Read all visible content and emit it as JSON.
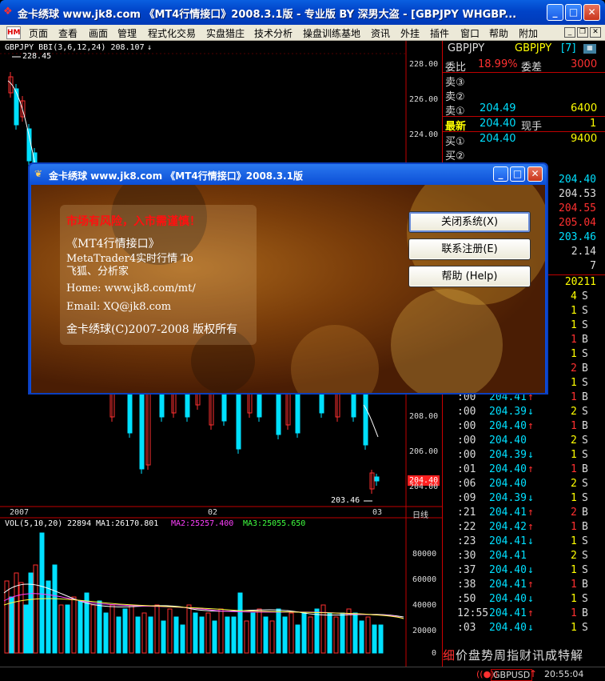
{
  "window": {
    "title": "金卡绣球 www.jk8.com 《MT4行情接口》2008.3.1版 - 专业版 BY 深男大盗 - [GBPJPY WHGBP...",
    "minimize": "_",
    "maximize": "□",
    "close": "✕"
  },
  "menu": {
    "items": [
      "页面",
      "查看",
      "画面",
      "管理",
      "程式化交易",
      "实盘猎庄",
      "技术分析",
      "操盘训练基地",
      "资讯",
      "外挂",
      "插件",
      "窗口",
      "帮助",
      "附加"
    ]
  },
  "chart": {
    "header": "GBPJPY BBI(3,6,12,24) 208.107",
    "header_arrow": "↓",
    "high_label": "228.45",
    "low_label": "203.46",
    "current_price": "204.40",
    "price_axis": [
      "228.00",
      "226.00",
      "224.00",
      "208.00",
      "206.00",
      "204.00"
    ],
    "date_axis": [
      "2007",
      "02",
      "03"
    ],
    "period": "日线",
    "volume_header": {
      "vol": "VOL(5,10,20)",
      "vol_value": "22894",
      "ma1": "MA1:26170.801",
      "ma2": "MA2:25257.400",
      "ma3": "MA3:25055.650"
    },
    "volume_axis": [
      "80000",
      "60000",
      "40000",
      "20000",
      "0"
    ]
  },
  "panel": {
    "symbol": "GBPJPY",
    "symbol_name": "GBPJPY",
    "symbol_suffix": "[7]",
    "ratio_label": "委比",
    "ratio_value": "18.99%",
    "diff_label": "委差",
    "diff_value": "3000",
    "sell": [
      {
        "label": "卖③",
        "price": "",
        "vol": ""
      },
      {
        "label": "卖②",
        "price": "",
        "vol": ""
      },
      {
        "label": "卖①",
        "price": "204.49",
        "vol": "6400"
      }
    ],
    "latest_label": "最新",
    "latest_price": "204.40",
    "current_hand_label": "现手",
    "current_hand_value": "1",
    "buy": [
      {
        "label": "买①",
        "price": "204.40",
        "vol": "9400"
      },
      {
        "label": "买②",
        "price": "",
        "vol": ""
      }
    ],
    "stats": [
      "204.40",
      "204.53",
      "204.55",
      "205.04",
      "203.46",
      "2.14",
      "7",
      "20211"
    ],
    "ticks": [
      {
        "time": "",
        "price": "",
        "dir": "",
        "vol": "4",
        "bs": "S"
      },
      {
        "time": "",
        "price": "",
        "dir": "",
        "vol": "1",
        "bs": "S"
      },
      {
        "time": "",
        "price": "",
        "dir": "",
        "vol": "1",
        "bs": "S"
      },
      {
        "time": "",
        "price": "",
        "dir": "",
        "vol": "1",
        "bs": "B"
      },
      {
        "time": "",
        "price": "",
        "dir": "",
        "vol": "1",
        "bs": "S"
      },
      {
        "time": "",
        "price": "",
        "dir": "",
        "vol": "2",
        "bs": "B"
      },
      {
        "time": "",
        "price": "",
        "dir": "",
        "vol": "1",
        "bs": "S"
      },
      {
        "time": ":00",
        "price": "204.41",
        "dir": "up",
        "vol": "1",
        "bs": "B"
      },
      {
        "time": ":00",
        "price": "204.39",
        "dir": "down",
        "vol": "2",
        "bs": "S"
      },
      {
        "time": ":00",
        "price": "204.40",
        "dir": "up",
        "vol": "1",
        "bs": "B"
      },
      {
        "time": ":00",
        "price": "204.40",
        "dir": "",
        "vol": "2",
        "bs": "S"
      },
      {
        "time": ":00",
        "price": "204.39",
        "dir": "down",
        "vol": "1",
        "bs": "S"
      },
      {
        "time": ":01",
        "price": "204.40",
        "dir": "up",
        "vol": "1",
        "bs": "B"
      },
      {
        "time": ":06",
        "price": "204.40",
        "dir": "",
        "vol": "2",
        "bs": "S"
      },
      {
        "time": ":09",
        "price": "204.39",
        "dir": "down",
        "vol": "1",
        "bs": "S"
      },
      {
        "time": ":21",
        "price": "204.41",
        "dir": "up",
        "vol": "2",
        "bs": "B"
      },
      {
        "time": ":22",
        "price": "204.42",
        "dir": "up",
        "vol": "1",
        "bs": "B"
      },
      {
        "time": ":23",
        "price": "204.41",
        "dir": "down",
        "vol": "1",
        "bs": "S"
      },
      {
        "time": ":30",
        "price": "204.41",
        "dir": "",
        "vol": "2",
        "bs": "S"
      },
      {
        "time": ":37",
        "price": "204.40",
        "dir": "down",
        "vol": "1",
        "bs": "S"
      },
      {
        "time": ":38",
        "price": "204.41",
        "dir": "up",
        "vol": "1",
        "bs": "B"
      },
      {
        "time": ":50",
        "price": "204.40",
        "dir": "down",
        "vol": "1",
        "bs": "S"
      },
      {
        "time": "12:55",
        "price": "204.41",
        "dir": "up",
        "vol": "1",
        "bs": "B"
      },
      {
        "time": ":03",
        "price": "204.40",
        "dir": "down",
        "vol": "1",
        "bs": "S"
      }
    ],
    "tabs": [
      "细",
      "价",
      "盘",
      "势",
      "周",
      "指",
      "财",
      "讯",
      "成",
      "特",
      "解"
    ]
  },
  "status": {
    "symbol": "GBPUSD",
    "arrow": "↑",
    "time": "20:55:04"
  },
  "dialog": {
    "title": "金卡绣球 www.jk8.com 《MT4行情接口》2008.3.1版",
    "warning": "市场有风险，入市需谨慎！",
    "product": "《MT4行情接口》",
    "desc1": "MetaTrader4实时行情 To",
    "desc2": "飞狐、分析家",
    "home": "Home: www.jk8.com/mt/",
    "email": "Email: XQ@jk8.com",
    "copyright": "金卡绣球(C)2007-2008 版权所有",
    "btn_close": "关闭系统(X)",
    "btn_register": "联系注册(E)",
    "btn_help": "帮助 (Help)"
  },
  "colors": {
    "up": "#ff3030",
    "down": "#00e0ff",
    "price": "#00e0ff",
    "yellow": "#ffff00",
    "axis": "#c00000"
  }
}
